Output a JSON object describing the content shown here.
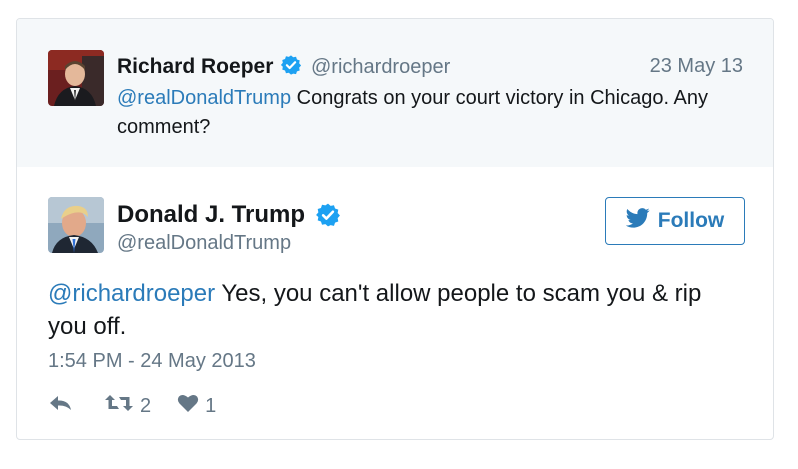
{
  "parent_tweet": {
    "author_name": "Richard Roeper",
    "handle": "@richardroeper",
    "date": "23 May 13",
    "mention": "@realDonaldTrump",
    "text": " Congrats on your court victory in Chicago. Any comment?"
  },
  "tweet": {
    "author_name": "Donald J. Trump",
    "handle": "@realDonaldTrump",
    "follow_label": "Follow",
    "mention": "@richardroeper",
    "text": " Yes, you can't allow people to scam you & rip you off.",
    "timestamp": "1:54 PM - 24 May 2013",
    "retweet_count": "2",
    "like_count": "1"
  },
  "icons": {
    "verified": "verified-badge-icon",
    "twitter_bird": "twitter-bird-icon",
    "reply": "reply-icon",
    "retweet": "retweet-icon",
    "like": "heart-icon"
  },
  "colors": {
    "link": "#2b7bb9",
    "verified": "#1da1f2",
    "muted": "#657786",
    "parent_background": "#f5f8fa",
    "border": "#dfe3e7"
  }
}
